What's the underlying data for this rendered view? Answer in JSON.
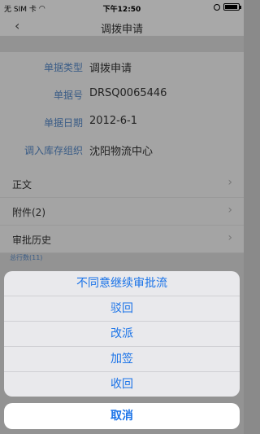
{
  "status_bar": {
    "carrier": "无 SIM 卡",
    "time": "下午12:50"
  },
  "nav": {
    "back_icon": "chevron-left-icon",
    "title": "调拨申请"
  },
  "form": [
    {
      "label": "单据类型",
      "value": "调拨申请"
    },
    {
      "label": "单据号",
      "value": "DRSQ0065446"
    },
    {
      "label": "单据日期",
      "value": "2012-6-1"
    },
    {
      "label": "调入库存组织",
      "value": "沈阳物流中心"
    }
  ],
  "menu": [
    {
      "label": "正文"
    },
    {
      "label": "附件(2)"
    },
    {
      "label": "审批历史"
    }
  ],
  "total_label": "总行数(11)",
  "action_sheet": {
    "items": [
      "不同意继续审批流",
      "驳回",
      "改派",
      "加签",
      "收回"
    ],
    "cancel": "取消"
  },
  "colors": {
    "accent": "#1a73e8",
    "label": "#3a5c86"
  }
}
